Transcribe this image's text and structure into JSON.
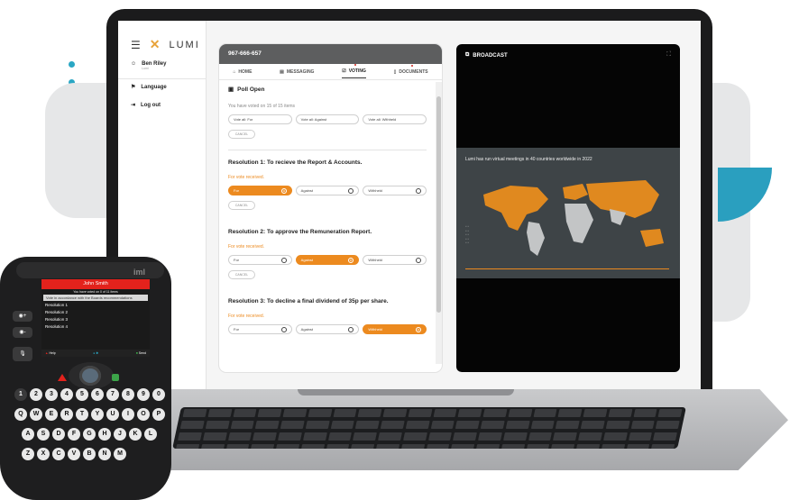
{
  "app": {
    "brand": "LUMI",
    "user_name": "Ben Riley",
    "user_sub": "Lumi",
    "sidebar_items": [
      {
        "label": "Language",
        "icon": "flag-icon"
      },
      {
        "label": "Log out",
        "icon": "logout-icon"
      }
    ],
    "meeting_id": "967-666-657",
    "tabs": [
      {
        "label": "HOME",
        "icon": "home-icon"
      },
      {
        "label": "MESSAGING",
        "icon": "messaging-icon"
      },
      {
        "label": "VOTING",
        "icon": "voting-icon"
      },
      {
        "label": "DOCUMENTS",
        "icon": "documents-icon"
      }
    ],
    "poll_title": "Poll Open",
    "voted_text": "You have voted on 15 of 15 items",
    "vote_all": [
      "Vote all: For",
      "Vote all: Against",
      "Vote all: Withheld"
    ],
    "cancel_label": "CANCEL",
    "resolutions": [
      {
        "title": "Resolution 1: To recieve the Report & Accounts.",
        "status": "For vote received.",
        "options": [
          "For",
          "Against",
          "Withheld"
        ],
        "selected": 0
      },
      {
        "title": "Resolution 2: To approve the Remuneration Report.",
        "status": "For vote received.",
        "options": [
          "For",
          "Against",
          "Withheld"
        ],
        "selected": 1
      },
      {
        "title": "Resolution 3: To decline a final dividend of 35p per share.",
        "status": "For vote received.",
        "options": [
          "For",
          "Against",
          "Withheld"
        ],
        "selected": 2
      }
    ]
  },
  "broadcast": {
    "label": "BROADCAST",
    "slide_text": "Lumi has run virtual meetings in  40 countries worldwide in 2022"
  },
  "device": {
    "brand": "iml",
    "name": "John Smith",
    "voted_text": "You have voted on 0 of 11 items",
    "highlight": "Vote in accordance with the Boards recommendations",
    "items": [
      "Resolution 1",
      "Resolution 2",
      "Resolution 3",
      "Resolution 4"
    ],
    "help_label": "Help",
    "send_label": "Send",
    "number_keys": [
      "1",
      "2",
      "3",
      "4",
      "5",
      "6",
      "7",
      "8",
      "9",
      "0"
    ],
    "row_q": [
      "Q",
      "W",
      "E",
      "R",
      "T",
      "Y",
      "U",
      "I",
      "O",
      "P"
    ],
    "row_a": [
      "A",
      "S",
      "D",
      "F",
      "G",
      "H",
      "J",
      "K",
      "L"
    ],
    "row_z": [
      "Z",
      "X",
      "C",
      "V",
      "B",
      "N",
      "M"
    ]
  },
  "colors": {
    "accent": "#ec8a1f",
    "teal": "#2aa7c4",
    "red": "#e3221c"
  }
}
